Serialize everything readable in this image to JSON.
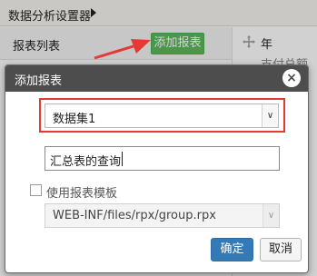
{
  "app": {
    "title": "数据分析设置器"
  },
  "background": {
    "list_title": "报表列表",
    "add_report_label": "添加报表",
    "field_label": "年",
    "field_label_2": "支付总额"
  },
  "dialog": {
    "title": "添加报表",
    "close_label": "×",
    "dataset_select_value": "数据集1",
    "report_name_value": "汇总表的查询",
    "use_template_label": "使用报表模板",
    "use_template_checked": false,
    "template_select_value": "WEB-INF/files/rpx/group.rpx",
    "template_select_disabled": true,
    "confirm_label": "确定",
    "cancel_label": "取消"
  },
  "colors": {
    "add_button": "#5cb85c",
    "confirm_button": "#337ab7",
    "highlight": "#e53935",
    "dialog_header": "#4d4d4d"
  },
  "icons": {
    "move": "move-icon",
    "dropdown": "chevron-down-icon",
    "close": "close-icon",
    "annotation": "red-arrow-annotation"
  }
}
